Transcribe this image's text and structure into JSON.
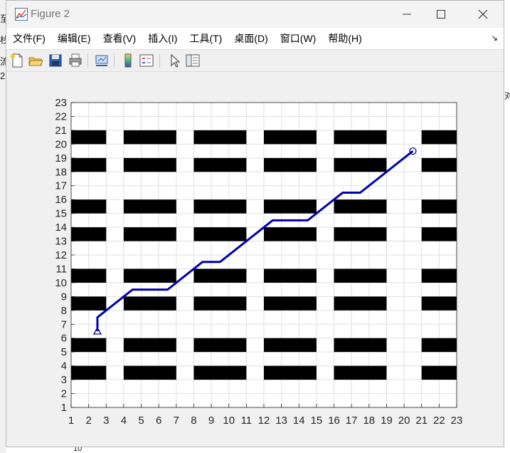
{
  "window": {
    "title": "Figure 2",
    "controls": [
      "minimize",
      "maximize",
      "close"
    ]
  },
  "menu": [
    {
      "label": "文件(F)"
    },
    {
      "label": "编辑(E)"
    },
    {
      "label": "查看(V)"
    },
    {
      "label": "插入(I)"
    },
    {
      "label": "工具(T)"
    },
    {
      "label": "桌面(D)"
    },
    {
      "label": "窗口(W)"
    },
    {
      "label": "帮助(H)"
    }
  ],
  "toolbar": {
    "icons": [
      "new-figure-icon",
      "open-file-icon",
      "save-icon",
      "print-icon",
      "link-plot-icon",
      "colorbar-icon",
      "legend-icon",
      "pointer-icon",
      "property-editor-icon"
    ]
  },
  "background_fragments": [
    "至",
    "栈",
    "流",
    "2",
    "对",
    "10"
  ],
  "chart_data": {
    "type": "line",
    "xlim": [
      1,
      23
    ],
    "ylim": [
      1,
      23
    ],
    "xticks": [
      1,
      2,
      3,
      4,
      5,
      6,
      7,
      8,
      9,
      10,
      11,
      12,
      13,
      14,
      15,
      16,
      17,
      18,
      19,
      20,
      21,
      22,
      23
    ],
    "yticks": [
      1,
      2,
      3,
      4,
      5,
      6,
      7,
      8,
      9,
      10,
      11,
      12,
      13,
      14,
      15,
      16,
      17,
      18,
      19,
      20,
      21,
      22,
      23
    ],
    "grid": true,
    "obstacles": [
      {
        "x": [
          1,
          3
        ],
        "y": [
          20,
          21
        ]
      },
      {
        "x": [
          4,
          7
        ],
        "y": [
          20,
          21
        ]
      },
      {
        "x": [
          8,
          11
        ],
        "y": [
          20,
          21
        ]
      },
      {
        "x": [
          12,
          15
        ],
        "y": [
          20,
          21
        ]
      },
      {
        "x": [
          16,
          19
        ],
        "y": [
          20,
          21
        ]
      },
      {
        "x": [
          21,
          23
        ],
        "y": [
          20,
          21
        ]
      },
      {
        "x": [
          1,
          3
        ],
        "y": [
          18,
          19
        ]
      },
      {
        "x": [
          4,
          7
        ],
        "y": [
          18,
          19
        ]
      },
      {
        "x": [
          8,
          11
        ],
        "y": [
          18,
          19
        ]
      },
      {
        "x": [
          12,
          15
        ],
        "y": [
          18,
          19
        ]
      },
      {
        "x": [
          16,
          19
        ],
        "y": [
          18,
          19
        ]
      },
      {
        "x": [
          21,
          23
        ],
        "y": [
          18,
          19
        ]
      },
      {
        "x": [
          1,
          3
        ],
        "y": [
          15,
          16
        ]
      },
      {
        "x": [
          4,
          7
        ],
        "y": [
          15,
          16
        ]
      },
      {
        "x": [
          8,
          11
        ],
        "y": [
          15,
          16
        ]
      },
      {
        "x": [
          12,
          15
        ],
        "y": [
          15,
          16
        ]
      },
      {
        "x": [
          16,
          19
        ],
        "y": [
          15,
          16
        ]
      },
      {
        "x": [
          21,
          23
        ],
        "y": [
          15,
          16
        ]
      },
      {
        "x": [
          1,
          3
        ],
        "y": [
          13,
          14
        ]
      },
      {
        "x": [
          4,
          7
        ],
        "y": [
          13,
          14
        ]
      },
      {
        "x": [
          8,
          11
        ],
        "y": [
          13,
          14
        ]
      },
      {
        "x": [
          12,
          15
        ],
        "y": [
          13,
          14
        ]
      },
      {
        "x": [
          16,
          19
        ],
        "y": [
          13,
          14
        ]
      },
      {
        "x": [
          21,
          23
        ],
        "y": [
          13,
          14
        ]
      },
      {
        "x": [
          1,
          3
        ],
        "y": [
          10,
          11
        ]
      },
      {
        "x": [
          4,
          7
        ],
        "y": [
          10,
          11
        ]
      },
      {
        "x": [
          8,
          11
        ],
        "y": [
          10,
          11
        ]
      },
      {
        "x": [
          12,
          15
        ],
        "y": [
          10,
          11
        ]
      },
      {
        "x": [
          16,
          19
        ],
        "y": [
          10,
          11
        ]
      },
      {
        "x": [
          21,
          23
        ],
        "y": [
          10,
          11
        ]
      },
      {
        "x": [
          1,
          3
        ],
        "y": [
          8,
          9
        ]
      },
      {
        "x": [
          4,
          7
        ],
        "y": [
          8,
          9
        ]
      },
      {
        "x": [
          8,
          11
        ],
        "y": [
          8,
          9
        ]
      },
      {
        "x": [
          12,
          15
        ],
        "y": [
          8,
          9
        ]
      },
      {
        "x": [
          16,
          19
        ],
        "y": [
          8,
          9
        ]
      },
      {
        "x": [
          21,
          23
        ],
        "y": [
          8,
          9
        ]
      },
      {
        "x": [
          1,
          3
        ],
        "y": [
          5,
          6
        ]
      },
      {
        "x": [
          4,
          7
        ],
        "y": [
          5,
          6
        ]
      },
      {
        "x": [
          8,
          11
        ],
        "y": [
          5,
          6
        ]
      },
      {
        "x": [
          12,
          15
        ],
        "y": [
          5,
          6
        ]
      },
      {
        "x": [
          16,
          19
        ],
        "y": [
          5,
          6
        ]
      },
      {
        "x": [
          21,
          23
        ],
        "y": [
          5,
          6
        ]
      },
      {
        "x": [
          1,
          3
        ],
        "y": [
          3,
          4
        ]
      },
      {
        "x": [
          4,
          7
        ],
        "y": [
          3,
          4
        ]
      },
      {
        "x": [
          8,
          11
        ],
        "y": [
          3,
          4
        ]
      },
      {
        "x": [
          12,
          15
        ],
        "y": [
          3,
          4
        ]
      },
      {
        "x": [
          16,
          19
        ],
        "y": [
          3,
          4
        ]
      },
      {
        "x": [
          21,
          23
        ],
        "y": [
          3,
          4
        ]
      }
    ],
    "obstacle_color": "#000000",
    "series": [
      {
        "color": "#0000b3",
        "x": [
          2.5,
          2.5,
          4.5,
          6.5,
          8.5,
          9.5,
          12.5,
          14.5,
          16.5,
          17.5,
          20.5
        ],
        "y": [
          6.5,
          7.5,
          9.5,
          9.5,
          11.5,
          11.5,
          14.5,
          14.5,
          16.5,
          16.5,
          19.5
        ]
      }
    ],
    "start": {
      "x": 2.5,
      "y": 6.5,
      "marker": "triangle"
    },
    "goal": {
      "x": 20.5,
      "y": 19.5,
      "marker": "circle"
    }
  }
}
